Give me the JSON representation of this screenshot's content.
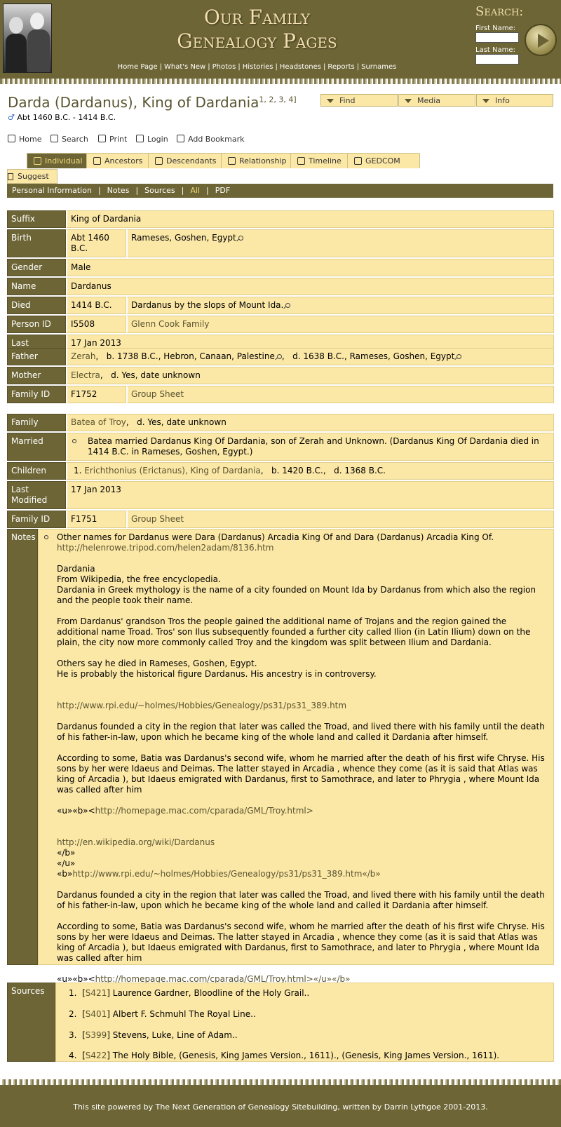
{
  "site": {
    "title_line1": "Our Family",
    "title_line2": "Genealogy Pages",
    "nav": [
      "Home Page",
      "What's New",
      "Photos",
      "Histories",
      "Headstones",
      "Reports",
      "Surnames"
    ]
  },
  "search": {
    "title": "Search:",
    "first_label": "First Name:",
    "last_label": "Last Name:",
    "first_value": "",
    "last_value": ""
  },
  "person": {
    "name": "Darda (Dardanus), King of Dardania",
    "refs": [
      "1",
      "2",
      "3",
      "4"
    ],
    "gender_symbol": "♂",
    "dates": "Abt 1460 B.C. - 1414 B.C."
  },
  "dropdowns": [
    "Find",
    "Media",
    "Info"
  ],
  "toolbar": [
    "Home",
    "Search",
    "Print",
    "Login",
    "Add Bookmark"
  ],
  "tabs": [
    "Individual",
    "Ancestors",
    "Descendants",
    "Relationship",
    "Timeline",
    "GEDCOM"
  ],
  "suggest": "Suggest",
  "subnav": [
    "Personal Information",
    "Notes",
    "Sources",
    "All",
    "PDF"
  ],
  "individual": {
    "suffix_label": "Suffix",
    "suffix": "King of Dardania",
    "birth_label": "Birth",
    "birth_date": "Abt 1460 B.C.",
    "birth_place": "Rameses, Goshen, Egypt",
    "gender_label": "Gender",
    "gender": "Male",
    "name_label": "Name",
    "name": "Dardanus",
    "died_label": "Died",
    "died_date": "1414 B.C.",
    "died_place": "Dardanus by the slops of Mount Ida.",
    "personid_label": "Person ID",
    "personid": "I5508",
    "tree": "Glenn Cook Family",
    "modified_label": "Last Modified",
    "modified": "17 Jan 2013"
  },
  "parents": {
    "father_label": "Father",
    "father": "Zerah",
    "father_b": "b. 1738 B.C., Hebron, Canaan, Palestine",
    "father_d": "d. 1638 B.C., Rameses, Goshen, Egypt",
    "mother_label": "Mother",
    "mother": "Electra",
    "mother_d": "d. Yes, date unknown",
    "famid_label": "Family ID",
    "famid": "F1752",
    "group": "Group Sheet"
  },
  "family": {
    "family_label": "Family",
    "spouse": "Batea of Troy",
    "spouse_d": "d. Yes, date unknown",
    "married_label": "Married",
    "married": "Batea married Dardanus King Of Dardania, son of Zerah and Unknown. (Dardanus King Of Dardania died in 1414 B.C. in Rameses, Goshen, Egypt.)",
    "children_label": "Children",
    "child_num": "1.",
    "child": "Erichthonius (Erictanus), King of Dardania",
    "child_b": "b. 1420 B.C.",
    "child_d": "d. 1368 B.C.",
    "modified_label": "Last Modified",
    "modified": "17 Jan 2013",
    "famid_label": "Family ID",
    "famid": "F1751",
    "group": "Group Sheet"
  },
  "notes": {
    "label": "Notes",
    "intro": "Other names for Dardanus were Dara (Dardanus) Arcadia King Of and Dara (Dardanus) Arcadia King Of.",
    "link1": "http://helenrowe.tripod.com/helen2adam/8136.htm",
    "p1a": "Dardania",
    "p1b": "From Wikipedia, the free encyclopedia.",
    "p1c": "Dardania in Greek mythology is the name of a city founded on Mount Ida by Dardanus from which also the region and the people took their name.",
    "p2": "From Dardanus' grandson Tros the people gained the additional name of Trojans and the region gained the additional name Troad. Tros' son Ilus subsequently founded a further city called Ilion (in Latin Ilium) down on the plain, the city now more commonly called Troy and the kingdom was split between Ilium and Dardania.",
    "p3a": "Others say he died in Rameses, Goshen, Egypt.",
    "p3b": "He is probably the historical figure Dardanus. His ancestry is in controversy.",
    "link2": "http://www.rpi.edu/~holmes/Hobbies/Genealogy/ps31/ps31_389.htm",
    "p4": "Dardanus founded a city in the region that later was called the Troad, and lived there with his family until the death of his father-in-law, upon which he became king of the whole land and called it Dardania after himself.",
    "p5": "According to some, Batia was Dardanus's second wife, whom he married after the death of his first wife Chryse. His sons by her were Idaeus and Deimas. The latter stayed in Arcadia , whence they come (as it is said that Atlas was king of Arcadia ), but Idaeus emigrated with Dardanus, first to Samothrace, and later to Phrygia , where Mount Ida was called after him",
    "tag1_prefix": "«u»«b»<",
    "link3": "http://homepage.mac.com/cparada/GML/Troy.html>",
    "link4": "http://en.wikipedia.org/wiki/Dardanus",
    "tag_b_close": "«/b»",
    "tag_u_close": "«/u»",
    "tag2_prefix": "«b»",
    "link5": "http://www.rpi.edu/~holmes/Hobbies/Genealogy/ps31/ps31_389.htm«/b»",
    "p6": "Dardanus founded a city in the region that later was called the Troad, and lived there with his family until the death of his father-in-law, upon which he became king of the whole land and called it Dardania after himself.",
    "p7": "According to some, Batia was Dardanus's second wife, whom he married after the death of his first wife Chryse. His sons by her were Idaeus and Deimas. The latter stayed in Arcadia , whence they come (as it is said that Atlas was king of Arcadia ), but Idaeus emigrated with Dardanus, first to Samothrace, and later to Phrygia , where Mount Ida was called after him",
    "tag3_prefix": "«u»«b»<",
    "link6": "http://homepage.mac.com/cparada/GML/Troy.html>«/u»«/b»"
  },
  "sources": {
    "label": "Sources",
    "items": [
      {
        "num": "1.",
        "id": "S421",
        "text": "Laurence Gardner, Bloodline of the Holy Grail.."
      },
      {
        "num": "2.",
        "id": "S401",
        "text": "Albert F. Schmuhl The Royal Line.."
      },
      {
        "num": "3.",
        "id": "S399",
        "text": "Stevens, Luke, Line of Adam.."
      },
      {
        "num": "4.",
        "id": "S422",
        "text": "The Holy Bible, (Genesis, King James Version., 1611)., (Genesis, King James Version., 1611)."
      }
    ]
  },
  "footer": {
    "prefix": "This site powered by ",
    "link": "The Next Generation of Genealogy Sitebuilding",
    "suffix": ", written by Darrin Lythgoe 2001-2013."
  }
}
